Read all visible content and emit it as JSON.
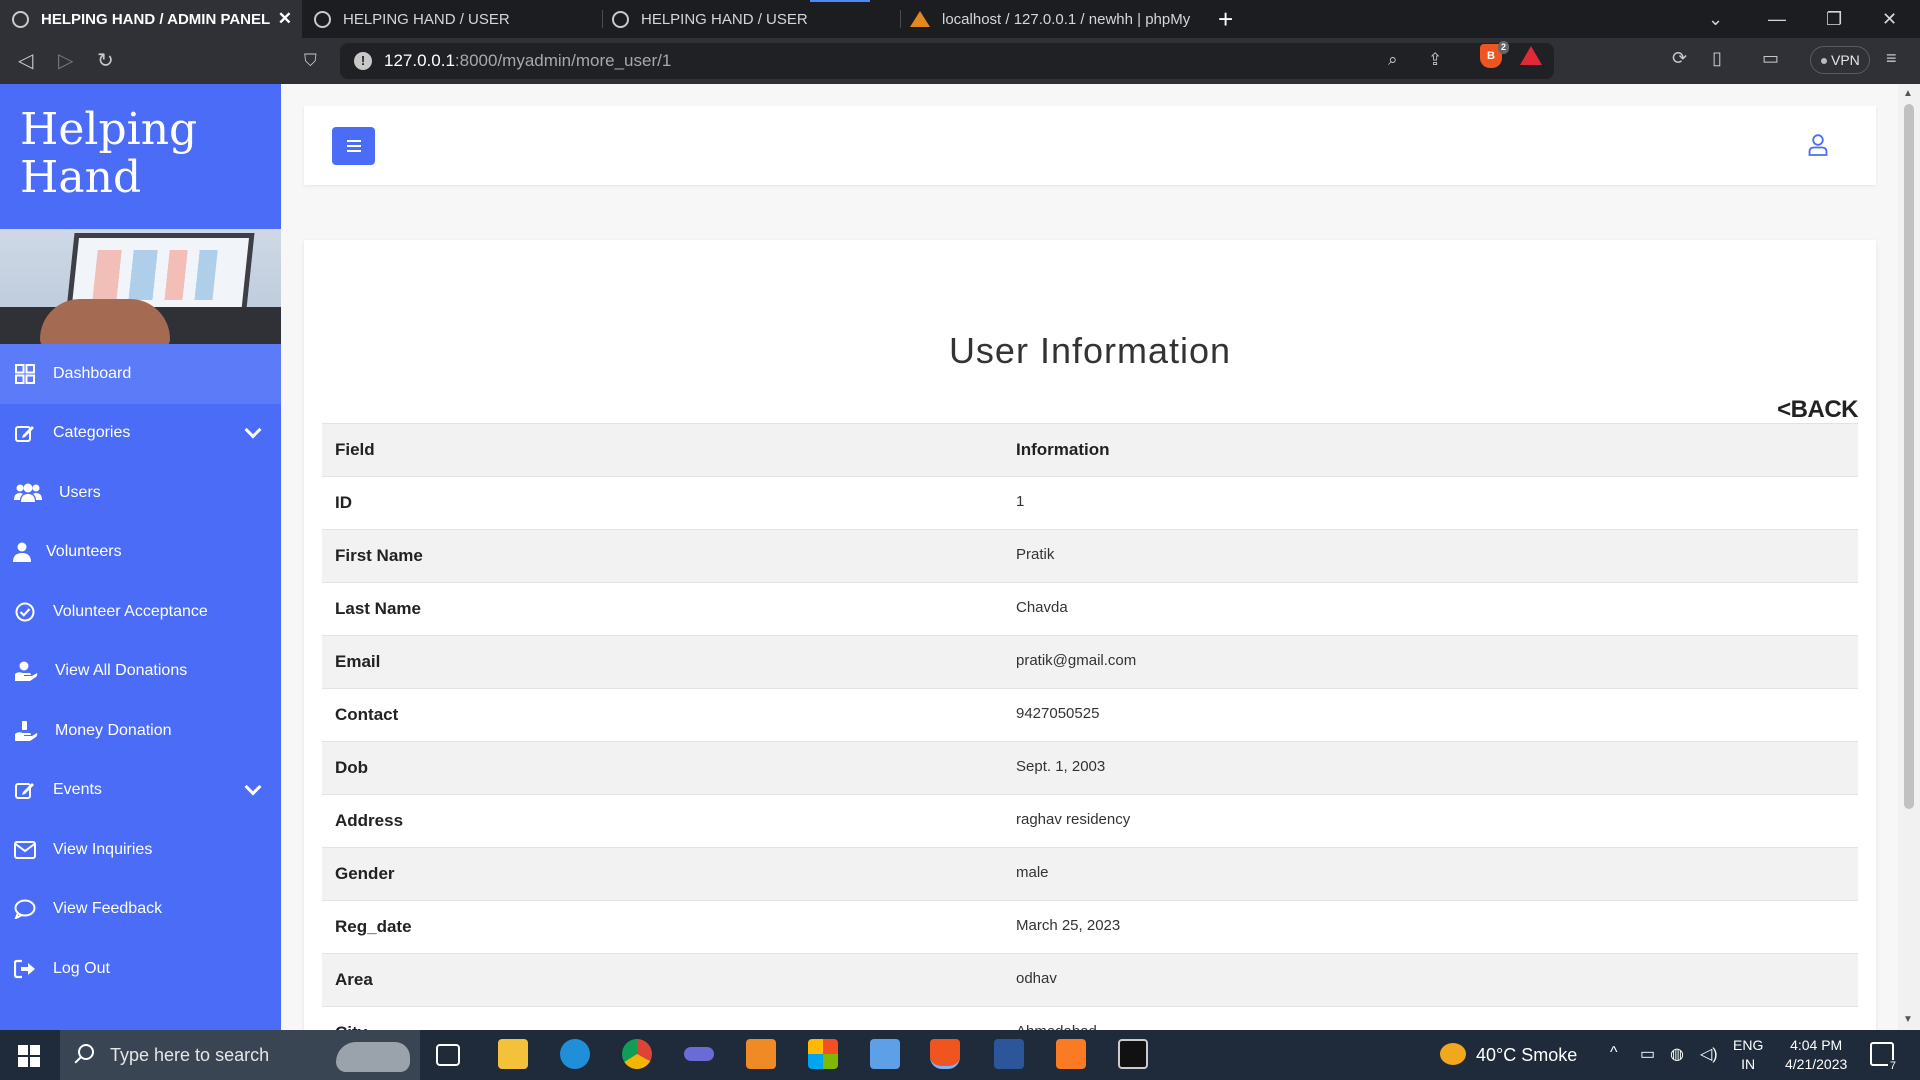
{
  "browser": {
    "tabs": [
      {
        "title": "HELPING HAND / ADMIN PANEL",
        "active": true
      },
      {
        "title": "HELPING HAND / USER",
        "active": false
      },
      {
        "title": "HELPING HAND / USER",
        "active": false
      },
      {
        "title": "localhost / 127.0.0.1 / newhh | phpMy",
        "active": false
      }
    ],
    "url_host": "127.0.0.1",
    "url_path": ":8000/myadmin/more_user/1",
    "brave_shield_count": "2",
    "vpn_label": "VPN"
  },
  "sidebar": {
    "brand_line1": "Helping",
    "brand_line2": "Hand",
    "color": "#4a6cf7",
    "items": [
      {
        "label": "Dashboard",
        "icon": "grid-icon",
        "active": true
      },
      {
        "label": "Categories",
        "icon": "edit-icon",
        "has_submenu": true
      },
      {
        "label": "Users",
        "icon": "users-icon"
      },
      {
        "label": "Volunteers",
        "icon": "user-icon"
      },
      {
        "label": "Volunteer Acceptance",
        "icon": "check-circle-icon"
      },
      {
        "label": "View All Donations",
        "icon": "hand-heart-icon"
      },
      {
        "label": "Money Donation",
        "icon": "hand-coin-icon"
      },
      {
        "label": "Events",
        "icon": "edit-icon",
        "has_submenu": true
      },
      {
        "label": "View Inquiries",
        "icon": "envelope-icon"
      },
      {
        "label": "View Feedback",
        "icon": "comment-icon"
      },
      {
        "label": "Log Out",
        "icon": "logout-icon"
      }
    ]
  },
  "main": {
    "title": "User Information",
    "back_label": "<BACK",
    "table": {
      "headers": [
        "Field",
        "Information"
      ],
      "rows": [
        {
          "field": "ID",
          "value": "1"
        },
        {
          "field": "First Name",
          "value": "Pratik"
        },
        {
          "field": "Last Name",
          "value": "Chavda"
        },
        {
          "field": "Email",
          "value": "pratik@gmail.com"
        },
        {
          "field": "Contact",
          "value": "9427050525"
        },
        {
          "field": "Dob",
          "value": "Sept. 1, 2003"
        },
        {
          "field": "Address",
          "value": "raghav residency"
        },
        {
          "field": "Gender",
          "value": "male"
        },
        {
          "field": "Reg_date",
          "value": "March 25, 2023"
        },
        {
          "field": "Area",
          "value": "odhav"
        },
        {
          "field": "City",
          "value": "Ahmedabad"
        }
      ]
    }
  },
  "taskbar": {
    "search_placeholder": "Type here to search",
    "weather": "40°C  Smoke",
    "lang_line1": "ENG",
    "lang_line2": "IN",
    "time": "4:04 PM",
    "date": "4/21/2023",
    "notification_count": "7"
  }
}
